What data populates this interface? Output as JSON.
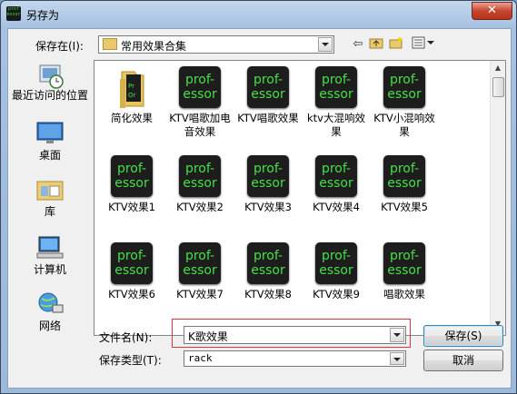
{
  "window": {
    "title": "另存为",
    "app_icon_text": "prof-essor",
    "close_label": "✕"
  },
  "save_in": {
    "label": "保存在(I):",
    "value": "常用效果合集"
  },
  "places": [
    {
      "label": "最近访问的位置",
      "icon": "recent-places-icon"
    },
    {
      "label": "桌面",
      "icon": "desktop-icon"
    },
    {
      "label": "库",
      "icon": "libraries-icon"
    },
    {
      "label": "计算机",
      "icon": "computer-icon"
    },
    {
      "label": "网络",
      "icon": "network-icon"
    }
  ],
  "files": [
    {
      "name": "简化效果",
      "type": "folder"
    },
    {
      "name": "KTV唱歌加电音效果",
      "type": "professor"
    },
    {
      "name": "KTV唱歌效果",
      "type": "professor"
    },
    {
      "name": "ktv大混响效果",
      "type": "professor"
    },
    {
      "name": "KTV小混响效果",
      "type": "professor"
    },
    {
      "name": "KTV效果1",
      "type": "professor"
    },
    {
      "name": "KTV效果2",
      "type": "professor"
    },
    {
      "name": "KTV效果3",
      "type": "professor"
    },
    {
      "name": "KTV效果4",
      "type": "professor"
    },
    {
      "name": "KTV效果5",
      "type": "professor"
    },
    {
      "name": "KTV效果6",
      "type": "professor"
    },
    {
      "name": "KTV效果7",
      "type": "professor"
    },
    {
      "name": "KTV效果8",
      "type": "professor"
    },
    {
      "name": "KTV效果9",
      "type": "professor"
    },
    {
      "name": "唱歌效果",
      "type": "professor"
    }
  ],
  "file_icon_text": {
    "line1": "prof-",
    "line2": "essor"
  },
  "filename": {
    "label": "文件名(N):",
    "value": "K歌效果"
  },
  "filetype": {
    "label": "保存类型(T):",
    "value": "rack"
  },
  "buttons": {
    "save": "保存(S)",
    "cancel": "取消"
  },
  "colors": {
    "professor_green": "#46e046",
    "highlight_red": "#d9383a"
  }
}
